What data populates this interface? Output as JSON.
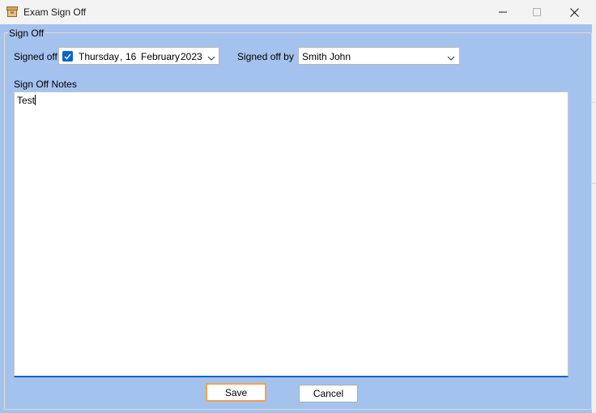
{
  "window": {
    "title": "Exam Sign Off",
    "icon": "archive-box-icon"
  },
  "group": {
    "label": "Sign Off"
  },
  "signed_off": {
    "label": "Signed off",
    "checked": true,
    "day_name": "Thursday",
    "separator": ",",
    "day": "16",
    "month": "February",
    "year": "2023"
  },
  "signed_off_by": {
    "label": "Signed off by",
    "value": "Smith John"
  },
  "notes": {
    "label": "Sign Off Notes",
    "value": "Test"
  },
  "buttons": {
    "save": "Save",
    "cancel": "Cancel"
  },
  "colors": {
    "client_bg": "#a4c2ee",
    "accent": "#0a63c9",
    "default_button_border": "#f3a24a"
  }
}
